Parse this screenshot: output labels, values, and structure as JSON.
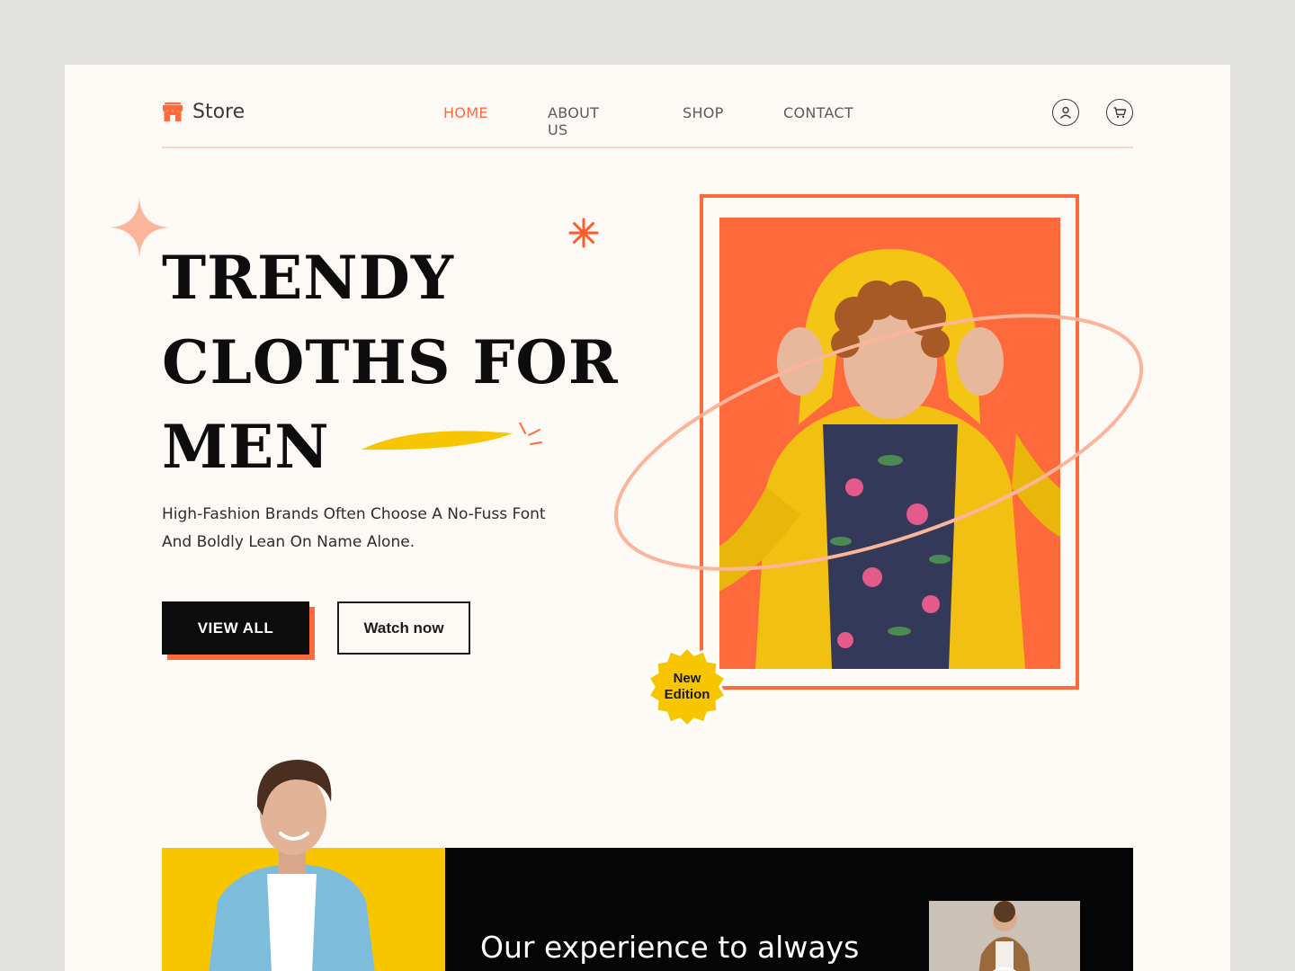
{
  "brand": {
    "name": "Store",
    "accent": "#ff6a3c",
    "yellow": "#f8c600"
  },
  "nav": {
    "items": [
      {
        "label": "HOME",
        "active": true
      },
      {
        "label": "ABOUT US",
        "active": false
      },
      {
        "label": "SHOP",
        "active": false
      },
      {
        "label": "CONTACT",
        "active": false
      }
    ]
  },
  "header_icons": [
    "user-icon",
    "cart-icon"
  ],
  "hero": {
    "title_lines": [
      "TRENDY",
      "CLOTHS FOR",
      "MEN"
    ],
    "subtitle": "High-Fashion Brands Often Choose A No-Fuss Font And Boldly Lean On Name Alone.",
    "primary_button": "VIEW ALL",
    "secondary_button": "Watch now",
    "badge_line1": "New",
    "badge_line2": "Edition"
  },
  "section2": {
    "headline": "Our experience to always"
  }
}
